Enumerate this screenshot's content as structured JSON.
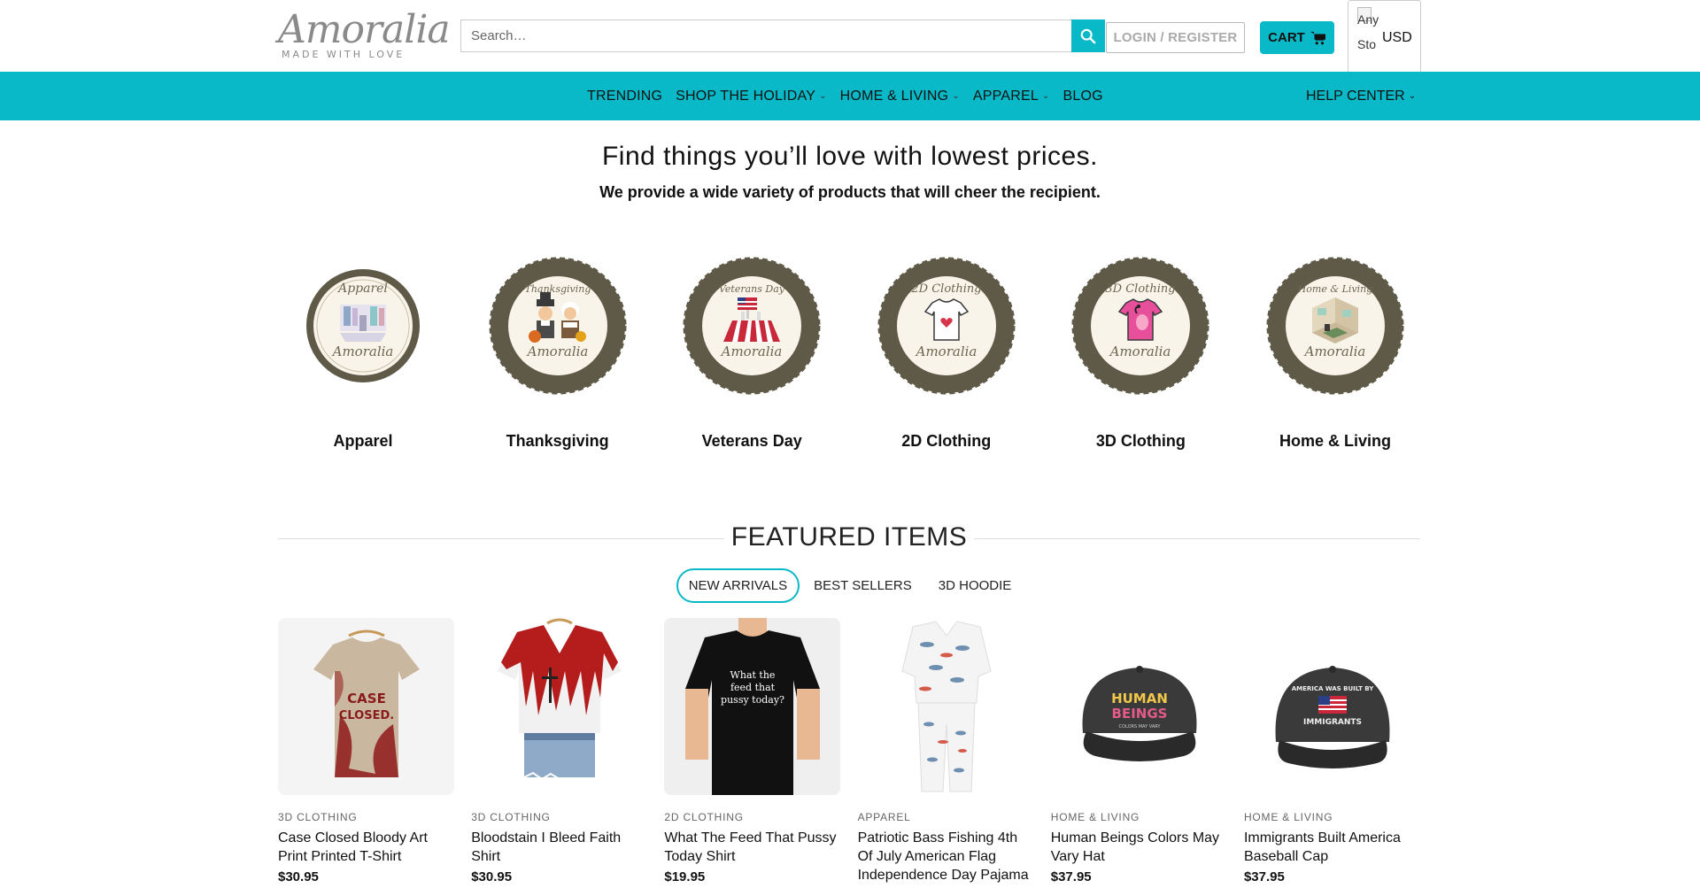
{
  "logo": {
    "script": "Amoralia",
    "tagline": "MADE WITH LOVE"
  },
  "search": {
    "placeholder": "Search…"
  },
  "header": {
    "login_label": "LOGIN / REGISTER",
    "cart_label": "CART",
    "currency_alt": "Any Sto",
    "currency": "USD"
  },
  "nav": {
    "items": [
      {
        "label": "TRENDING",
        "dropdown": false
      },
      {
        "label": "SHOP THE HOLIDAY",
        "dropdown": true
      },
      {
        "label": "HOME & LIVING",
        "dropdown": true
      },
      {
        "label": "APPAREL",
        "dropdown": true
      },
      {
        "label": "BLOG",
        "dropdown": false
      }
    ],
    "help_label": "HELP CENTER"
  },
  "hero": {
    "title": "Find things you’ll love with lowest prices.",
    "subtitle": "We provide a wide variety of products that will cheer the recipient."
  },
  "categories": [
    {
      "label": "Apparel",
      "badge_title": "Apparel",
      "badge_brand": "Amoralia",
      "icon": "clothing-rack-icon"
    },
    {
      "label": "Thanksgiving",
      "badge_title": "Thanksgiving",
      "badge_brand": "Amoralia",
      "icon": "pilgrims-icon"
    },
    {
      "label": "Veterans Day",
      "badge_title": "Veterans Day",
      "badge_brand": "Amoralia",
      "icon": "flag-memorial-icon"
    },
    {
      "label": "2D Clothing",
      "badge_title": "2D Clothing",
      "badge_brand": "Amoralia",
      "icon": "tshirt-heart-icon"
    },
    {
      "label": "3D Clothing",
      "badge_title": "3D Clothing",
      "badge_brand": "Amoralia",
      "icon": "flamingo-shirt-icon"
    },
    {
      "label": "Home & Living",
      "badge_title": "Home & Living",
      "badge_brand": "Amoralia",
      "icon": "room-icon"
    }
  ],
  "featured": {
    "title": "FEATURED ITEMS",
    "tabs": [
      "NEW ARRIVALS",
      "BEST SELLERS",
      "3D HOODIE"
    ],
    "active_tab": 0
  },
  "products": [
    {
      "category": "3D CLOTHING",
      "name": "Case Closed Bloody Art Print Printed T-Shirt",
      "price": "$30.95",
      "image": "case-closed-tshirt",
      "shirt_text": "CASE CLOSED."
    },
    {
      "category": "3D CLOTHING",
      "name": "Bloodstain I Bleed Faith Shirt",
      "price": "$30.95",
      "image": "bleed-faith-shirt"
    },
    {
      "category": "2D CLOTHING",
      "name": "What The Feed That Pussy Today Shirt",
      "price": "$19.95",
      "image": "black-tshirt",
      "shirt_text": "What the feed that pussy today?"
    },
    {
      "category": "APPAREL",
      "name": "Patriotic Bass Fishing 4th Of July American Flag Independence Day Pajama",
      "price": "",
      "image": "fish-pajama"
    },
    {
      "category": "HOME & LIVING",
      "name": "Human Beings Colors May Vary Hat",
      "price": "$37.95",
      "image": "human-beings-hat",
      "hat_text": "HUMAN BEINGS",
      "hat_sub": "COLORS MAY VARY"
    },
    {
      "category": "HOME & LIVING",
      "name": "Immigrants Built America Baseball Cap",
      "price": "$37.95",
      "image": "immigrants-hat",
      "hat_text": "AMERICA WAS BUILT BY",
      "hat_sub": "IMMIGRANTS"
    }
  ],
  "colors": {
    "accent": "#0ab9c7",
    "badge": "#5f5a48",
    "badge_inner": "#f8f4ea"
  }
}
